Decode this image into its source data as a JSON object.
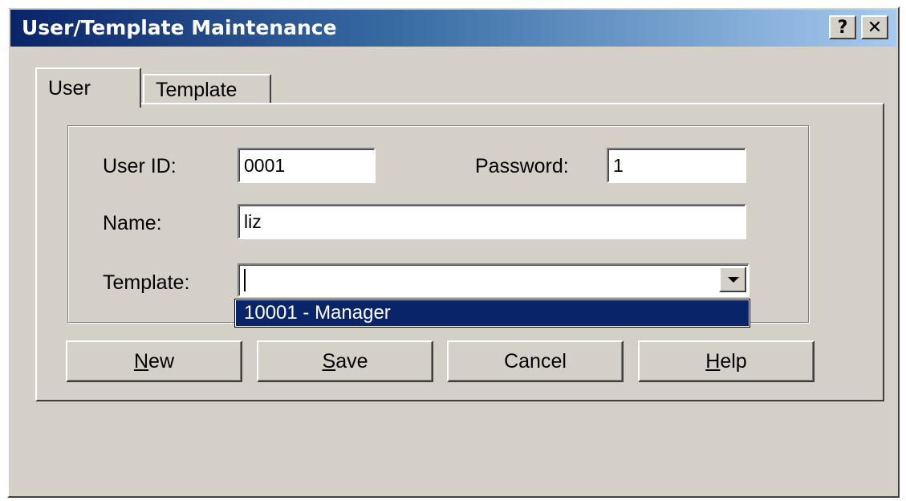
{
  "window": {
    "title": "User/Template Maintenance",
    "help_button": "?",
    "close_button": "✕"
  },
  "tabs": [
    {
      "label": "User",
      "active": true
    },
    {
      "label": "Template",
      "active": false
    }
  ],
  "form": {
    "user_id_label": "User ID:",
    "user_id_value": "0001",
    "password_label": "Password:",
    "password_value": "1",
    "name_label": "Name:",
    "name_value": "liz",
    "template_label": "Template:",
    "template_value": "",
    "template_options": [
      "10001 - Manager"
    ]
  },
  "buttons": {
    "new": {
      "mnemonic": "N",
      "rest": "ew"
    },
    "save": {
      "mnemonic": "S",
      "rest": "ave"
    },
    "cancel": {
      "label": "Cancel"
    },
    "help": {
      "mnemonic": "H",
      "rest": "elp"
    }
  },
  "colors": {
    "title_gradient_start": "#0a246a",
    "title_gradient_end": "#a6caf0",
    "selection_background": "#0a246a",
    "face": "#d4d0c8"
  }
}
